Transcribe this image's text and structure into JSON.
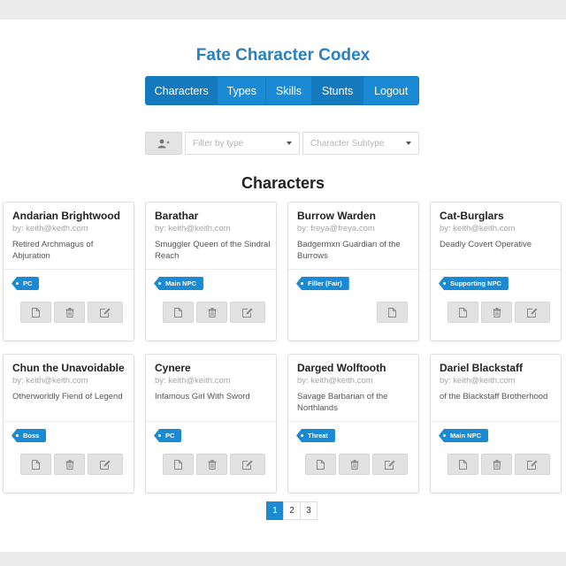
{
  "app_title": "Fate Character Codex",
  "nav": [
    "Characters",
    "Types",
    "Skills",
    "Stunts",
    "Logout"
  ],
  "filters": {
    "type_placeholder": "Filter by type",
    "subtype_placeholder": "Character Subtype"
  },
  "section_title": "Characters",
  "characters": [
    {
      "name": "Andarian Brightwood",
      "author": "by: keith@keith.com",
      "description": "Retired Archmagus of Abjuration",
      "tag": "PC"
    },
    {
      "name": "Barathar",
      "author": "by: keith@keith.com",
      "description": "Smuggler Queen of the Sindral Reach",
      "tag": "Main NPC"
    },
    {
      "name": "Burrow Warden",
      "author": "by: freya@freya.com",
      "description": "Badgermxn Guardian of the Burrows",
      "tag": "Filler (Fair)"
    },
    {
      "name": "Cat-Burglars",
      "author": "by: keith@keith.com",
      "description": "Deadly Covert Operative",
      "tag": "Supporting NPC"
    },
    {
      "name": "Chun the Unavoidable",
      "author": "by: keith@keith.com",
      "description": "Otherworldly Fiend of Legend",
      "tag": "Boss"
    },
    {
      "name": "Cynere",
      "author": "by: keith@keith.com",
      "description": "Infamous Girl With Sword",
      "tag": "PC"
    },
    {
      "name": "Darged Wolftooth",
      "author": "by: keith@keith.com",
      "description": "Savage Barbarian of the Northlands",
      "tag": "Threat"
    },
    {
      "name": "Dariel Blackstaff",
      "author": "by: keith@keith.com",
      "description": "of the Blackstaff Brotherhood",
      "tag": "Main NPC"
    }
  ],
  "pagination": {
    "pages": [
      "1",
      "2",
      "3"
    ],
    "current": "1"
  },
  "colors": {
    "accent": "#1a8ad4",
    "title": "#2a7fc1",
    "button_gray": "#e2e2e2"
  },
  "icons": {
    "add_user": "user-plus-icon",
    "view": "file-icon",
    "delete": "trash-icon",
    "edit": "edit-icon"
  }
}
